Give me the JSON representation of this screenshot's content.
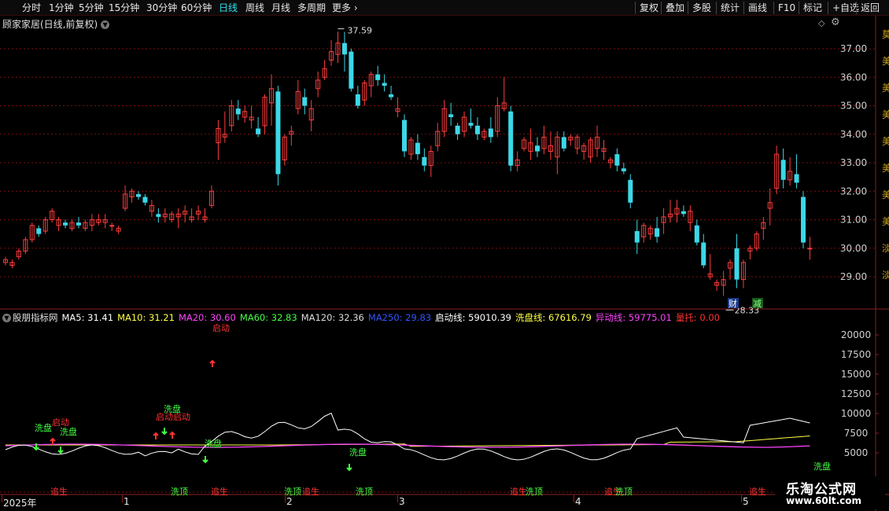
{
  "toolbar": {
    "periods": [
      "分时",
      "1分钟",
      "5分钟",
      "15分钟",
      "30分钟",
      "60分钟",
      "日线",
      "周线",
      "月线",
      "多周期",
      "更多"
    ],
    "active_period": "日线",
    "more_icon": "chevron-right-icon",
    "buttons": [
      "复权",
      "叠加",
      "多股",
      "统计",
      "画线",
      "F10",
      "标记",
      "+自选",
      "返回"
    ]
  },
  "main_chart": {
    "title": "顾家家居(日线,前复权)",
    "price_axis": [
      "37.00",
      "36.00",
      "35.00",
      "34.00",
      "33.00",
      "32.00",
      "31.00",
      "30.00",
      "29.00"
    ],
    "high_label": "37.59",
    "low_label": "28.33",
    "badge_cai": "财",
    "badge_jian": "减",
    "right_edge_chars": "莫美美美美美美美淡淡",
    "colors": {
      "up": "#ff3c3c",
      "down": "#3bd8e8",
      "grid": "#7a1010",
      "axis_text": "#cfcfcf"
    }
  },
  "indicator": {
    "name": "股朋指标网",
    "legend": [
      {
        "text": "MA5: 31.41",
        "color": "#ffffff"
      },
      {
        "text": "MA10: 31.21",
        "color": "#ffff44"
      },
      {
        "text": "MA20: 30.60",
        "color": "#ff44ff"
      },
      {
        "text": "MA60: 32.83",
        "color": "#44ff44"
      },
      {
        "text": "MA120: 32.36",
        "color": "#dddddd"
      },
      {
        "text": "MA250: 29.83",
        "color": "#3355ff"
      },
      {
        "text": "启动线: 59010.39",
        "color": "#ffffff"
      },
      {
        "text": "洗盘线: 67616.79",
        "color": "#ffff44"
      },
      {
        "text": "异动线: 59775.01",
        "color": "#ff44ff"
      },
      {
        "text": "量托: 0.00",
        "color": "#ff3333"
      }
    ],
    "axis": [
      "20000",
      "17500",
      "15000",
      "12500",
      "10000",
      "7500",
      "5000"
    ],
    "signals": {
      "qidong": "启动",
      "xipan": "洗盘",
      "qidong_double": "启动启动",
      "xiding": "洗顶",
      "zhuisheng": "追生"
    }
  },
  "date_axis": {
    "labels": [
      "2025年",
      "1",
      "2",
      "3",
      "4",
      "5"
    ]
  },
  "watermark": {
    "line1": "乐淘公式网",
    "line2": "www.60lt.com"
  },
  "chart_data": {
    "type": "candlestick",
    "title": "顾家家居(日线,前复权)",
    "y_range": [
      28.0,
      38.0
    ],
    "high": 37.59,
    "low": 28.33,
    "candles": [
      [
        29.5,
        29.7,
        29.4,
        29.6
      ],
      [
        29.4,
        29.6,
        29.3,
        29.5
      ],
      [
        29.7,
        30.0,
        29.6,
        29.9
      ],
      [
        29.9,
        30.4,
        29.8,
        30.3
      ],
      [
        30.3,
        30.9,
        30.2,
        30.8
      ],
      [
        30.7,
        30.8,
        30.4,
        30.5
      ],
      [
        30.6,
        31.1,
        30.5,
        31.0
      ],
      [
        31.0,
        31.4,
        30.9,
        31.3
      ],
      [
        30.8,
        31.1,
        30.6,
        31.0
      ],
      [
        30.9,
        31.0,
        30.7,
        30.8
      ],
      [
        30.7,
        31.0,
        30.6,
        30.9
      ],
      [
        30.9,
        31.1,
        30.7,
        30.8
      ],
      [
        30.7,
        31.0,
        30.6,
        30.9
      ],
      [
        30.8,
        31.2,
        30.6,
        31.0
      ],
      [
        30.9,
        31.2,
        30.8,
        31.0
      ],
      [
        30.9,
        31.2,
        30.7,
        31.0
      ],
      [
        30.8,
        30.9,
        30.6,
        30.8
      ],
      [
        30.6,
        30.8,
        30.5,
        30.7
      ],
      [
        31.4,
        32.2,
        31.3,
        31.9
      ],
      [
        31.8,
        32.1,
        31.6,
        32.0
      ],
      [
        31.9,
        32.0,
        31.7,
        31.8
      ],
      [
        31.8,
        31.9,
        31.5,
        31.6
      ],
      [
        31.3,
        31.7,
        31.1,
        31.5
      ],
      [
        31.2,
        31.4,
        30.9,
        31.1
      ],
      [
        31.1,
        31.4,
        30.9,
        31.2
      ],
      [
        31.0,
        31.3,
        30.9,
        31.2
      ],
      [
        31.1,
        31.4,
        30.7,
        31.2
      ],
      [
        31.2,
        31.5,
        30.9,
        31.3
      ],
      [
        31.0,
        31.4,
        30.9,
        31.1
      ],
      [
        31.2,
        31.5,
        31.0,
        31.3
      ],
      [
        31.0,
        31.4,
        30.9,
        31.1
      ],
      [
        31.5,
        32.2,
        31.4,
        32.0
      ],
      [
        33.7,
        34.5,
        33.1,
        34.2
      ],
      [
        33.9,
        34.8,
        33.7,
        34.0
      ],
      [
        34.3,
        35.2,
        34.1,
        35.0
      ],
      [
        34.9,
        35.2,
        34.5,
        34.7
      ],
      [
        34.6,
        35.0,
        34.4,
        34.8
      ],
      [
        34.5,
        35.0,
        34.2,
        34.6
      ],
      [
        34.2,
        34.6,
        33.9,
        34.0
      ],
      [
        34.3,
        35.4,
        34.0,
        35.3
      ],
      [
        35.1,
        36.1,
        34.3,
        35.6
      ],
      [
        35.5,
        35.7,
        32.2,
        32.6
      ],
      [
        33.1,
        34.0,
        32.9,
        33.9
      ],
      [
        34.0,
        34.3,
        33.6,
        34.1
      ],
      [
        34.9,
        35.9,
        34.7,
        35.5
      ],
      [
        35.3,
        35.6,
        34.7,
        35.0
      ],
      [
        34.5,
        35.2,
        34.1,
        34.9
      ],
      [
        35.6,
        36.2,
        35.3,
        35.9
      ],
      [
        36.0,
        36.6,
        35.9,
        36.3
      ],
      [
        36.6,
        37.3,
        36.4,
        36.9
      ],
      [
        36.8,
        37.6,
        36.5,
        37.2
      ],
      [
        37.2,
        37.59,
        36.2,
        36.8
      ],
      [
        36.9,
        37.0,
        35.5,
        35.6
      ],
      [
        35.4,
        35.7,
        34.9,
        35.0
      ],
      [
        35.2,
        35.9,
        35.0,
        35.8
      ],
      [
        35.7,
        36.2,
        35.3,
        36.1
      ],
      [
        36.1,
        36.4,
        35.7,
        35.9
      ],
      [
        35.8,
        36.1,
        35.5,
        35.7
      ],
      [
        35.4,
        35.7,
        35.2,
        35.3
      ],
      [
        34.8,
        35.3,
        34.6,
        34.9
      ],
      [
        34.5,
        34.7,
        33.2,
        33.4
      ],
      [
        33.3,
        33.9,
        33.1,
        33.8
      ],
      [
        33.7,
        34.0,
        33.1,
        33.3
      ],
      [
        33.2,
        33.5,
        32.7,
        32.9
      ],
      [
        32.9,
        33.6,
        32.5,
        33.4
      ],
      [
        33.6,
        34.4,
        33.4,
        34.1
      ],
      [
        34.1,
        35.2,
        33.9,
        34.9
      ],
      [
        34.7,
        35.1,
        34.3,
        34.6
      ],
      [
        34.3,
        34.4,
        33.8,
        34.0
      ],
      [
        34.1,
        34.8,
        33.9,
        34.6
      ],
      [
        34.4,
        34.9,
        34.2,
        34.3
      ],
      [
        34.3,
        34.6,
        33.8,
        34.0
      ],
      [
        33.9,
        34.2,
        33.8,
        34.1
      ],
      [
        34.2,
        34.6,
        33.7,
        33.9
      ],
      [
        34.1,
        35.3,
        33.9,
        35.0
      ],
      [
        34.9,
        36.0,
        34.8,
        35.1
      ],
      [
        34.8,
        35.0,
        32.7,
        32.9
      ],
      [
        32.9,
        33.4,
        32.7,
        33.1
      ],
      [
        33.5,
        33.9,
        33.4,
        33.8
      ],
      [
        33.4,
        34.2,
        33.1,
        33.7
      ],
      [
        33.6,
        33.9,
        33.2,
        33.4
      ],
      [
        33.5,
        34.3,
        33.3,
        33.9
      ],
      [
        33.4,
        34.1,
        33.1,
        33.6
      ],
      [
        33.2,
        34.1,
        32.6,
        33.9
      ],
      [
        33.9,
        34.1,
        33.4,
        33.5
      ],
      [
        33.8,
        34.0,
        33.6,
        33.9
      ],
      [
        33.5,
        34.0,
        33.3,
        33.9
      ],
      [
        33.4,
        33.7,
        33.1,
        33.6
      ],
      [
        33.2,
        33.9,
        33.0,
        33.8
      ],
      [
        33.5,
        34.3,
        33.2,
        33.9
      ],
      [
        33.4,
        33.8,
        33.1,
        33.5
      ],
      [
        33.0,
        33.2,
        32.8,
        33.1
      ],
      [
        33.3,
        33.5,
        32.7,
        32.9
      ],
      [
        32.8,
        33.0,
        32.6,
        32.7
      ],
      [
        32.4,
        32.6,
        31.4,
        31.6
      ],
      [
        30.6,
        31.0,
        29.8,
        30.2
      ],
      [
        30.4,
        30.9,
        30.2,
        30.8
      ],
      [
        30.5,
        30.8,
        30.3,
        30.7
      ],
      [
        30.7,
        31.1,
        30.2,
        30.4
      ],
      [
        30.9,
        31.4,
        30.5,
        31.1
      ],
      [
        31.1,
        31.7,
        30.9,
        31.2
      ],
      [
        31.2,
        31.7,
        30.9,
        31.4
      ],
      [
        31.3,
        31.5,
        31.1,
        31.2
      ],
      [
        30.9,
        31.5,
        30.6,
        31.3
      ],
      [
        30.8,
        31.0,
        30.1,
        30.2
      ],
      [
        30.2,
        30.5,
        29.3,
        29.4
      ],
      [
        29.0,
        29.8,
        28.9,
        29.1
      ],
      [
        28.7,
        28.9,
        28.5,
        28.8
      ],
      [
        28.7,
        29.2,
        28.33,
        28.9
      ],
      [
        29.3,
        29.6,
        28.9,
        29.5
      ],
      [
        30.0,
        30.5,
        28.6,
        28.9
      ],
      [
        28.9,
        29.6,
        28.6,
        29.5
      ],
      [
        29.9,
        30.1,
        29.6,
        30.0
      ],
      [
        30.0,
        30.6,
        29.9,
        30.5
      ],
      [
        30.7,
        31.1,
        30.3,
        30.9
      ],
      [
        31.4,
        32.1,
        30.8,
        31.6
      ],
      [
        32.1,
        33.6,
        31.9,
        33.3
      ],
      [
        33.1,
        33.5,
        32.1,
        32.4
      ],
      [
        32.4,
        33.2,
        32.2,
        32.7
      ],
      [
        32.6,
        33.3,
        32.1,
        32.3
      ],
      [
        31.8,
        32.0,
        30.0,
        30.2
      ],
      [
        30.0,
        30.4,
        29.6,
        30.0
      ]
    ],
    "indicator_series": [
      {
        "name": "启动线",
        "color": "#ffffff"
      },
      {
        "name": "洗盘线",
        "color": "#ffff44"
      },
      {
        "name": "异动线",
        "color": "#ff44ff"
      }
    ],
    "indicator_y_range": [
      2500,
      22500
    ]
  }
}
